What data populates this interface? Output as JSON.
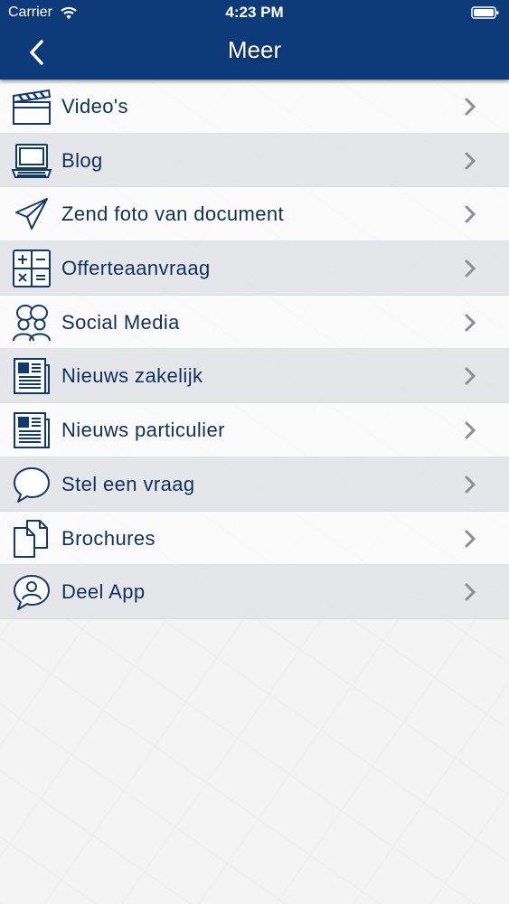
{
  "status_bar": {
    "carrier": "Carrier",
    "time": "4:23 PM"
  },
  "nav": {
    "title": "Meer",
    "back_icon": "chevron-left-icon"
  },
  "menu": {
    "items": [
      {
        "label": "Video's",
        "icon": "clapperboard-icon"
      },
      {
        "label": "Blog",
        "icon": "laptop-icon"
      },
      {
        "label": "Zend foto van document",
        "icon": "paper-plane-icon"
      },
      {
        "label": "Offerteaanvraag",
        "icon": "calculator-icon"
      },
      {
        "label": "Social Media",
        "icon": "people-icon"
      },
      {
        "label": "Nieuws zakelijk",
        "icon": "newspaper-icon"
      },
      {
        "label": "Nieuws particulier",
        "icon": "newspaper-icon"
      },
      {
        "label": "Stel een vraag",
        "icon": "speech-bubble-icon"
      },
      {
        "label": "Brochures",
        "icon": "documents-icon"
      },
      {
        "label": "Deel App",
        "icon": "share-person-icon"
      }
    ]
  },
  "colors": {
    "header": "#0d3a78",
    "text": "#10305f",
    "icon": "#123a6e",
    "chevron": "#8e8e93"
  }
}
